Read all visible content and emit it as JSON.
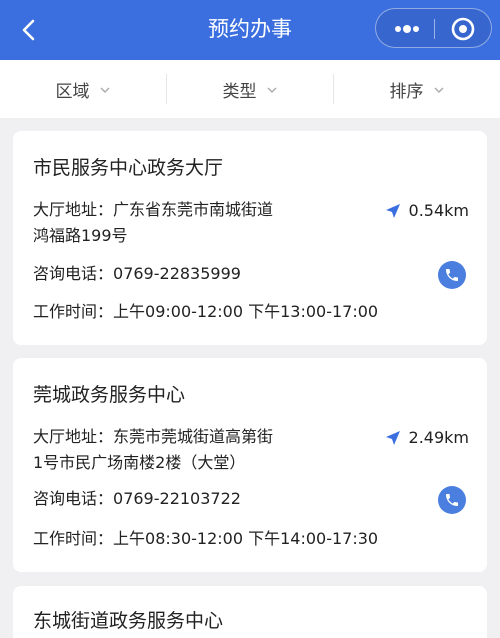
{
  "header": {
    "title": "预约办事",
    "back_icon": "chevron-left-icon",
    "more_icon": "more-dots-icon",
    "close_icon": "target-circle-icon",
    "background": "#3b6fe0"
  },
  "filters": [
    {
      "label": "区域"
    },
    {
      "label": "类型"
    },
    {
      "label": "排序"
    }
  ],
  "cards": [
    {
      "name": "市民服务中心政务大厅",
      "address_label": "大厅地址：",
      "address_line1": "广东省东莞市南城街道",
      "address_line2": "鸿福路199号",
      "distance": "0.54km",
      "phone_label": "咨询电话：",
      "phone": "0769-22835999",
      "hours_label": "工作时间：",
      "hours": "上午09:00-12:00 下午13:00-17:00"
    },
    {
      "name": "莞城政务服务中心",
      "address_label": "大厅地址：",
      "address_line1": "东莞市莞城街道高第街",
      "address_line2": "1号市民广场南楼2楼（大堂）",
      "distance": "2.49km",
      "phone_label": "咨询电话：",
      "phone": "0769-22103722",
      "hours_label": "工作时间：",
      "hours": "上午08:30-12:00 下午14:00-17:30"
    },
    {
      "name": "东城街道政务服务中心"
    }
  ],
  "colors": {
    "accent": "#3b6fe0",
    "phone_button": "#4a7fe0",
    "location_arrow": "#3b6fe0"
  }
}
